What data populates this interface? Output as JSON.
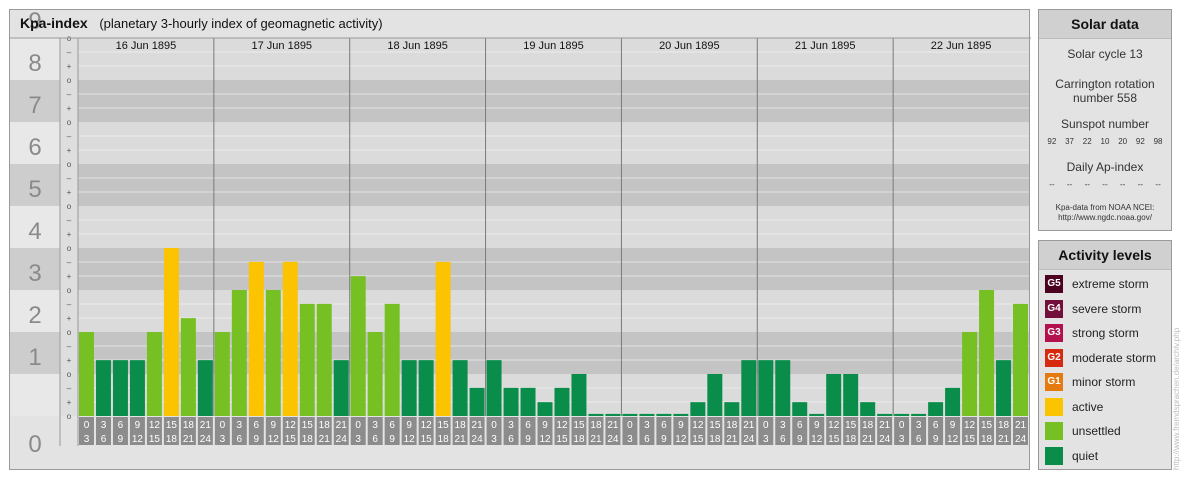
{
  "chart_data": {
    "type": "bar",
    "title": "Kpa-index",
    "subtitle": "(planetary 3-hourly index of geomagnetic activity)",
    "days": [
      "16 Jun 1895",
      "17 Jun 1895",
      "18 Jun 1895",
      "19 Jun 1895",
      "20 Jun 1895",
      "21 Jun 1895",
      "22 Jun 1895"
    ],
    "hour_ranges_top": [
      "0",
      "3",
      "6",
      "9",
      "12",
      "15",
      "18",
      "21"
    ],
    "hour_ranges_bottom": [
      "3",
      "6",
      "9",
      "12",
      "15",
      "18",
      "21",
      "24"
    ],
    "y_major_ticks": [
      "0",
      "1",
      "2",
      "3",
      "4",
      "5",
      "6",
      "7",
      "8",
      "9"
    ],
    "y_minor_labels": [
      "o",
      "+",
      "–"
    ],
    "ylim": [
      0,
      9
    ],
    "values": [
      2,
      1.33,
      1.33,
      1.33,
      2,
      4,
      2.33,
      1.33,
      2,
      3,
      3.67,
      3,
      3.67,
      2.67,
      2.67,
      1.33,
      3.33,
      2,
      2.67,
      1.33,
      1.33,
      3.67,
      1.33,
      0.67,
      1.33,
      0.67,
      0.67,
      0.33,
      0.67,
      1,
      0,
      0,
      0,
      0,
      0,
      0,
      0.33,
      1,
      0.33,
      1.33,
      1.33,
      1.33,
      0.33,
      0,
      1,
      1,
      0.33,
      0,
      0,
      0,
      0.33,
      0.67,
      2,
      3,
      1.33,
      2.67
    ]
  },
  "colors": {
    "quiet": "#0a8d4a",
    "unsettled": "#77c023",
    "active": "#fbc300",
    "band_dark": "#c4c4c4",
    "band_light": "#dbdbdb"
  },
  "solar": {
    "title": "Solar data",
    "cycle": "Solar cycle 13",
    "carrington_1": "Carrington rotation",
    "carrington_2": "number 558",
    "sunspot_label": "Sunspot number",
    "sunspots": [
      "92",
      "37",
      "22",
      "10",
      "20",
      "92",
      "98"
    ],
    "ap_label": "Daily Ap-index",
    "ap_values": [
      "--",
      "--",
      "--",
      "--",
      "--",
      "--",
      "--"
    ],
    "credit_1": "Kpa-data from NOAA NCEI:",
    "credit_2": "http://www.ngdc.noaa.gov/"
  },
  "activity": {
    "title": "Activity levels",
    "levels": [
      {
        "badge": "G5",
        "label": "extreme storm",
        "color": "#4d0020"
      },
      {
        "badge": "G4",
        "label": "severe storm",
        "color": "#720f3b"
      },
      {
        "badge": "G3",
        "label": "strong storm",
        "color": "#b5104e"
      },
      {
        "badge": "G2",
        "label": "moderate storm",
        "color": "#d62a0e"
      },
      {
        "badge": "G1",
        "label": "minor storm",
        "color": "#e57b10"
      },
      {
        "badge": "",
        "label": "active",
        "color": "#fbc300"
      },
      {
        "badge": "",
        "label": "unsettled",
        "color": "#77c023"
      },
      {
        "badge": "",
        "label": "quiet",
        "color": "#0a8d4a"
      }
    ]
  },
  "watermark": "http://www.fremdsprachen.de/archiv.php"
}
